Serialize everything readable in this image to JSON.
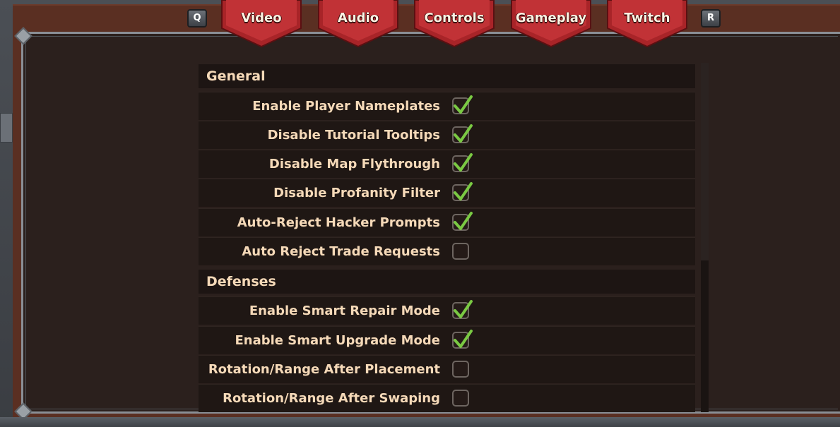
{
  "tabs": {
    "prev_key": "Q",
    "next_key": "R",
    "items": [
      {
        "label": "Video"
      },
      {
        "label": "Audio"
      },
      {
        "label": "Controls"
      },
      {
        "label": "Gameplay"
      },
      {
        "label": "Twitch"
      }
    ]
  },
  "colors": {
    "tab_red": "#b0262a",
    "check_green": "#7ac943",
    "label_cream": "#f5d9b8"
  },
  "sections": [
    {
      "title": "General",
      "options": [
        {
          "label": "Enable Player Nameplates",
          "checked": true
        },
        {
          "label": "Disable Tutorial Tooltips",
          "checked": true
        },
        {
          "label": "Disable Map Flythrough",
          "checked": true
        },
        {
          "label": "Disable Profanity Filter",
          "checked": true
        },
        {
          "label": "Auto-Reject Hacker Prompts",
          "checked": true
        },
        {
          "label": "Auto Reject Trade Requests",
          "checked": false
        }
      ]
    },
    {
      "title": "Defenses",
      "options": [
        {
          "label": "Enable Smart Repair Mode",
          "checked": true
        },
        {
          "label": "Enable Smart Upgrade Mode",
          "checked": true
        },
        {
          "label": "Rotation/Range After Placement",
          "checked": false
        },
        {
          "label": "Rotation/Range After Swaping",
          "checked": false
        }
      ]
    }
  ]
}
